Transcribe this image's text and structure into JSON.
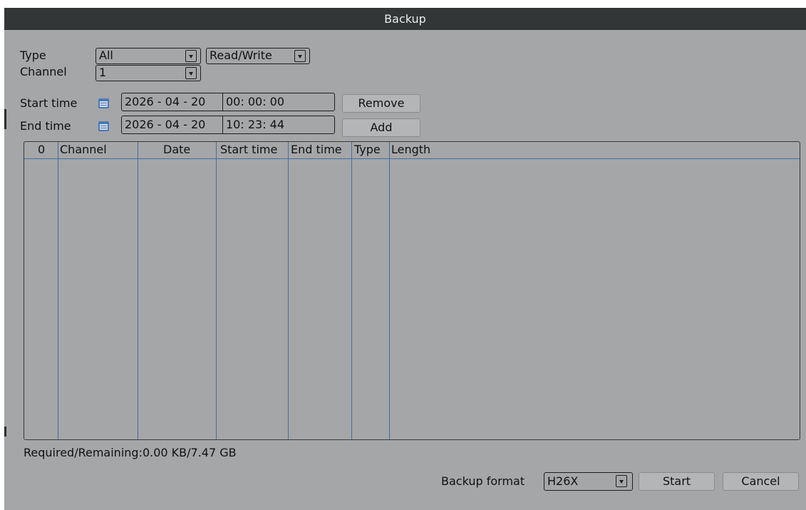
{
  "window": {
    "title": "Backup"
  },
  "filters": {
    "type_label": "Type",
    "type_value": "All",
    "mode_value": "Read/Write",
    "channel_label": "Channel",
    "channel_value": "1",
    "start_label": "Start time",
    "start_date": "2026 - 04 - 20",
    "start_time": "00: 00: 00",
    "end_label": "End time",
    "end_date": "2026 - 04 - 20",
    "end_time": "10: 23: 44",
    "remove_label": "Remove",
    "add_label": "Add"
  },
  "table": {
    "columns": [
      "0",
      "Channel",
      "Date",
      "Start time",
      "End time",
      "Type",
      "Length"
    ],
    "rows": []
  },
  "status": {
    "text": "Required/Remaining:0.00 KB/7.47 GB"
  },
  "footer": {
    "format_label": "Backup format",
    "format_value": "H26X",
    "start_label": "Start",
    "cancel_label": "Cancel"
  },
  "icons": {
    "dropdown": "chevron-down-icon",
    "date_picker": "calendar-icon"
  },
  "colors": {
    "title_bar": "#323637",
    "panel": "#a5a6a7",
    "grid_lines": "#3f6fa8",
    "calendar_icon": "#4b79b7"
  }
}
